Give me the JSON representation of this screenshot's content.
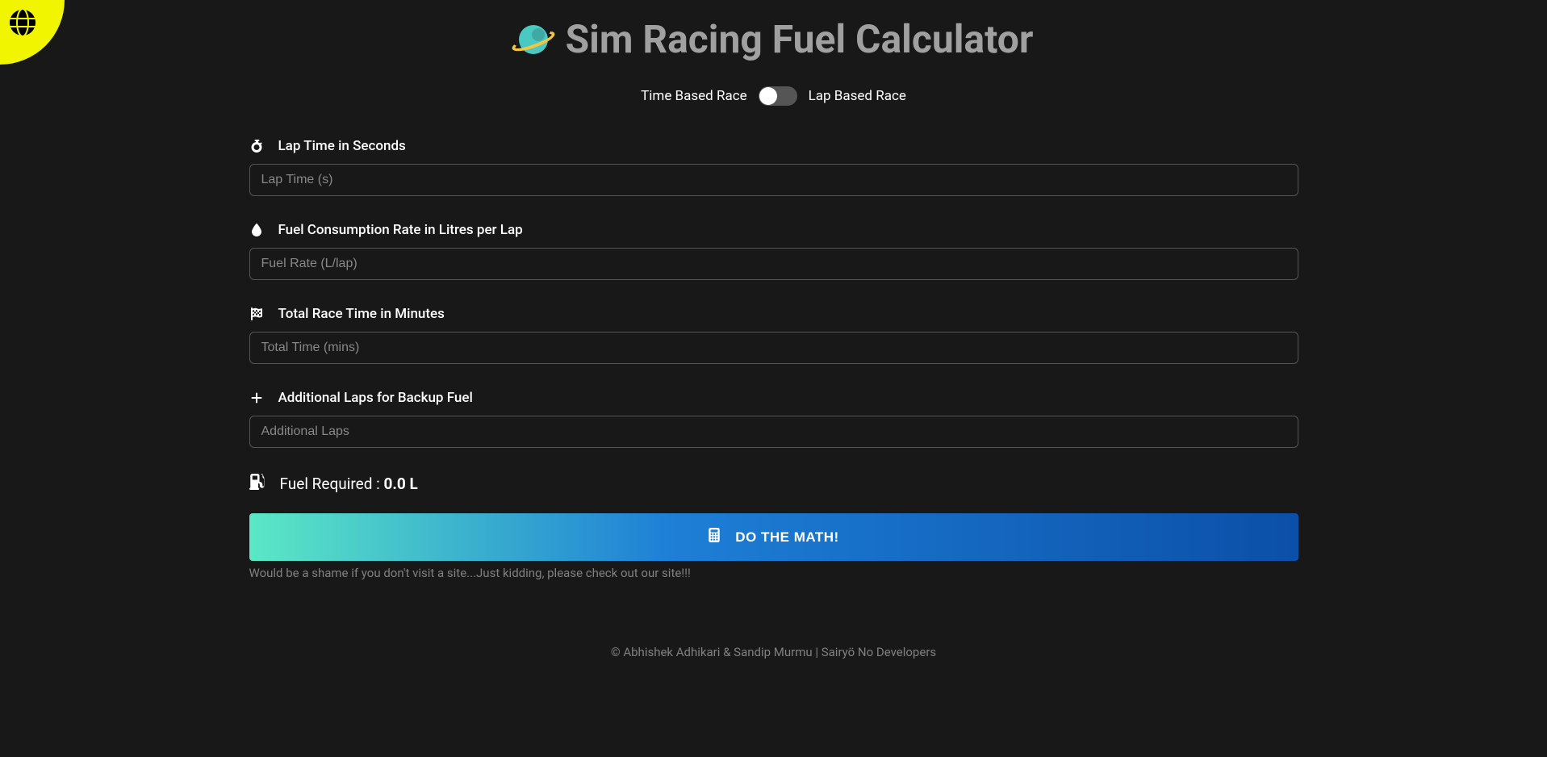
{
  "header": {
    "title": "Sim Racing Fuel Calculator"
  },
  "toggle": {
    "left_label": "Time Based Race",
    "right_label": "Lap Based Race",
    "state": "time"
  },
  "fields": {
    "lap_time": {
      "label": "Lap Time in Seconds",
      "placeholder": "Lap Time (s)",
      "value": ""
    },
    "fuel_rate": {
      "label": "Fuel Consumption Rate in Litres per Lap",
      "placeholder": "Fuel Rate (L/lap)",
      "value": ""
    },
    "race_time": {
      "label": "Total Race Time in Minutes",
      "placeholder": "Total Time (mins)",
      "value": ""
    },
    "additional_laps": {
      "label": "Additional Laps for Backup Fuel",
      "placeholder": "Additional Laps",
      "value": ""
    }
  },
  "result": {
    "label": "Fuel Required : ",
    "value": "0.0 L"
  },
  "button": {
    "label": "DO THE MATH!"
  },
  "promo": {
    "text": "Would be a shame if you don't visit a site...Just kidding, please check out our site!!!"
  },
  "footer": {
    "text": "© Abhishek Adhikari & Sandip Murmu | Sairyö No Developers"
  }
}
